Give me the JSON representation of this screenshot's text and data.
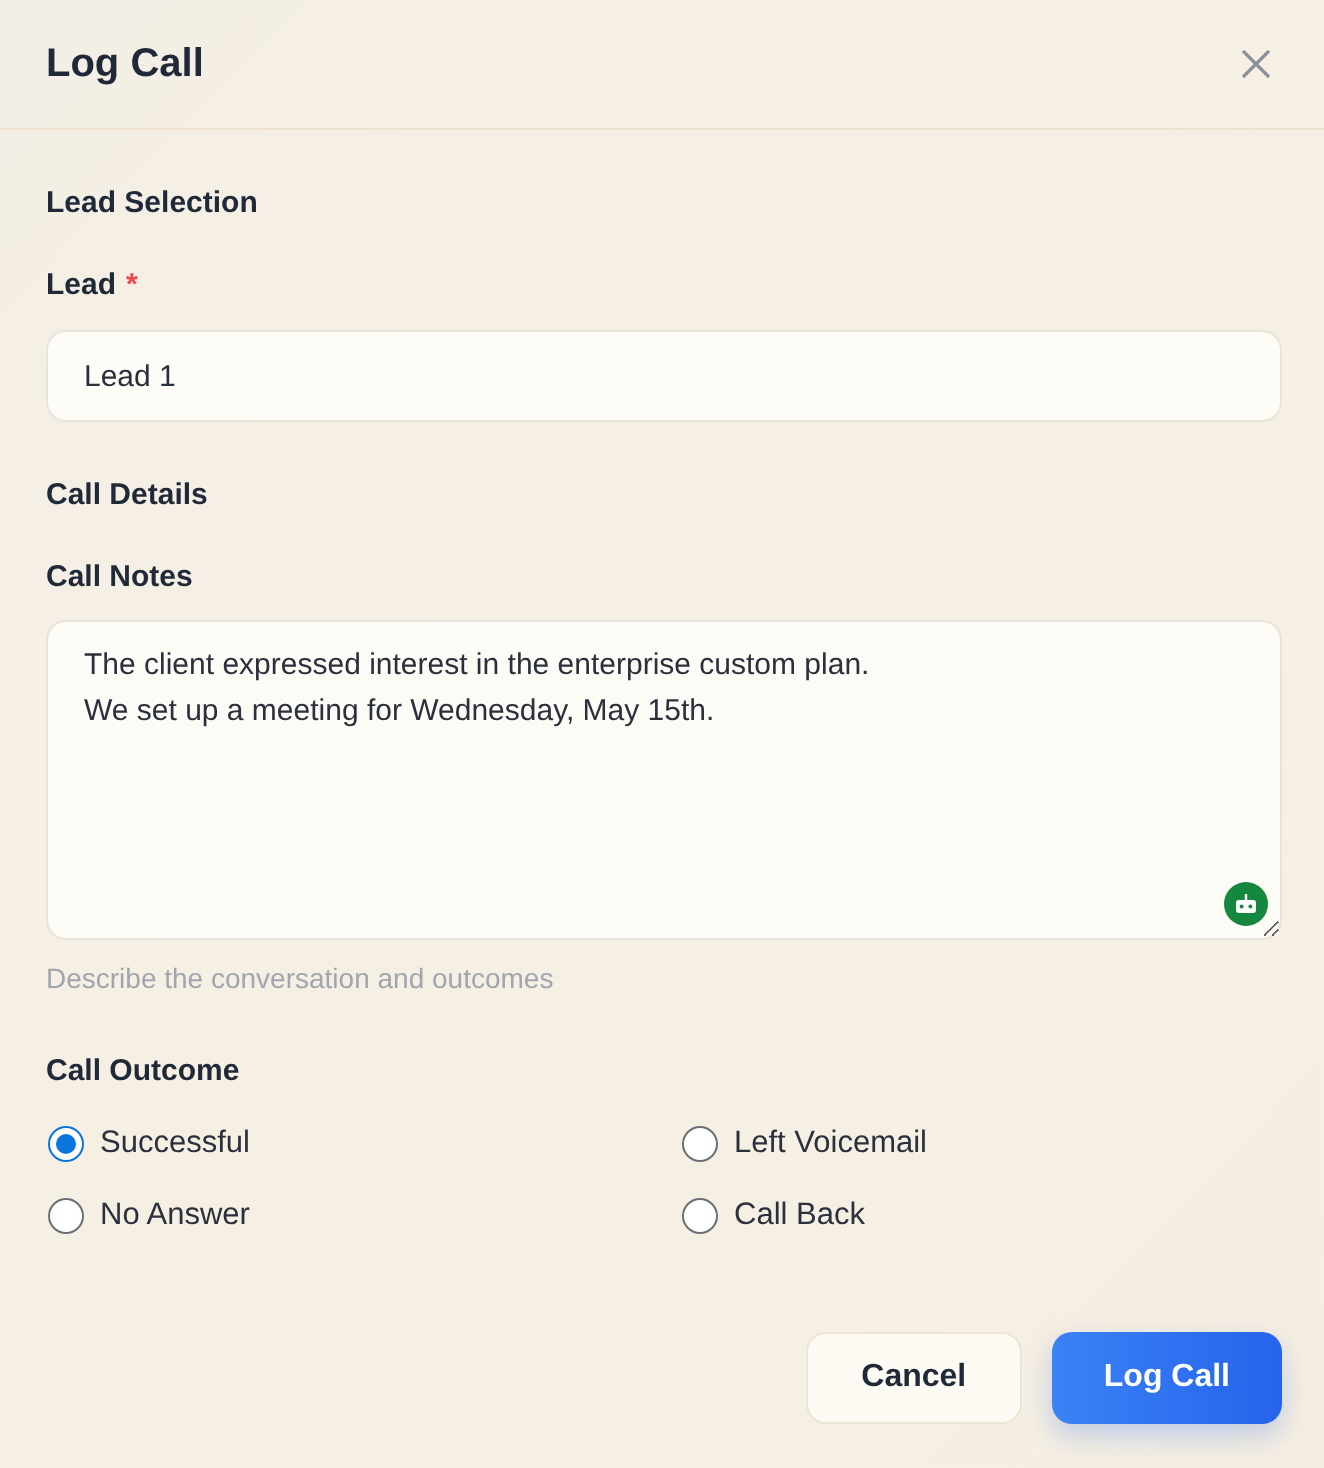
{
  "dialog": {
    "title": "Log Call"
  },
  "sections": [
    {
      "title": "Lead Selection",
      "fields": [
        {
          "kind": "input",
          "label": "Lead",
          "required_mark": "*",
          "value": "Lead 1"
        }
      ]
    },
    {
      "title": "Call Details",
      "fields": [
        {
          "kind": "textarea",
          "label": "Call Notes",
          "value": "The client expressed interest in the enterprise custom plan.\nWe set up a meeting for Wednesday, May 15th.",
          "help": "Describe the conversation and outcomes"
        }
      ]
    }
  ],
  "outcome": {
    "label": "Call Outcome",
    "options": [
      {
        "label": "Successful",
        "selected": true
      },
      {
        "label": "Left Voicemail",
        "selected": false
      },
      {
        "label": "No Answer",
        "selected": false
      },
      {
        "label": "Call Back",
        "selected": false
      }
    ]
  },
  "buttons": [
    {
      "label": "Cancel",
      "kind": "secondary"
    },
    {
      "label": "Log Call",
      "kind": "primary"
    }
  ]
}
